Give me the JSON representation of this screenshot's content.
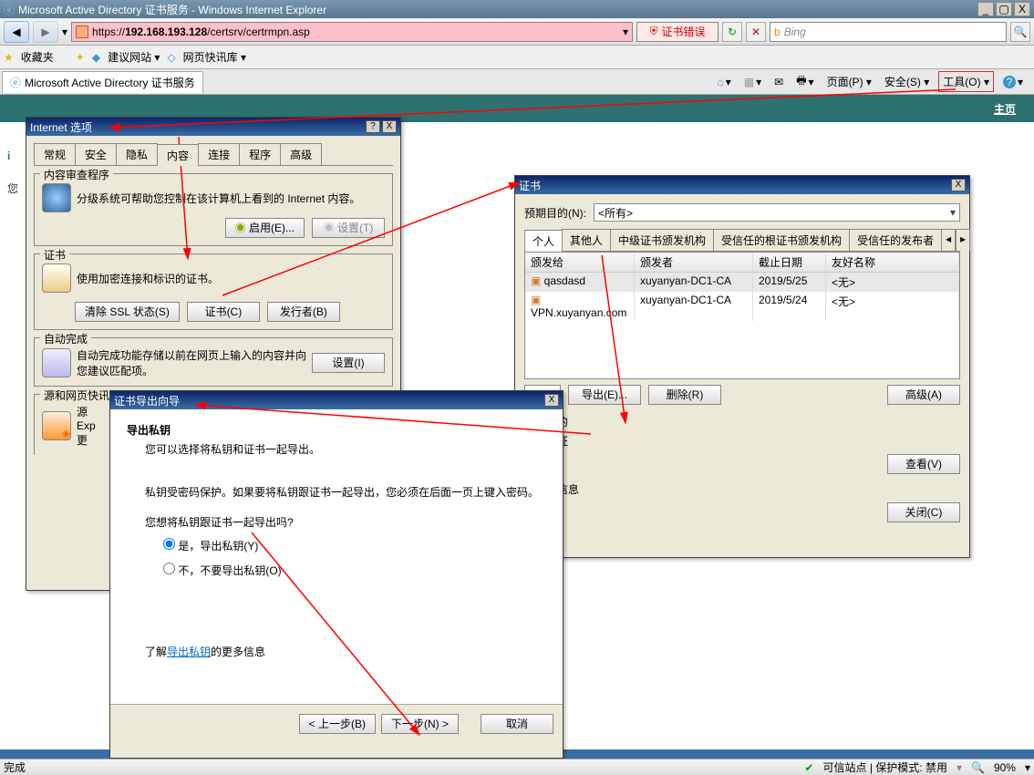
{
  "window": {
    "title": "Microsoft Active Directory 证书服务 - Windows Internet Explorer",
    "min": "_",
    "max": "▢",
    "close": "X"
  },
  "toolbar": {
    "url_prefix": "https://",
    "url_host": "192.168.193.128",
    "url_path": "/certsrv/certrmpn.asp",
    "cert_error": "证书错误",
    "search_placeholder": "Bing"
  },
  "favrow": {
    "label": "收藏夹",
    "suggest": "建议网站 ▾",
    "feed": "网页快讯库 ▾"
  },
  "tabrow": {
    "tab_title": "Microsoft Active Directory 证书服务",
    "menu": {
      "page": "页面(P) ▾",
      "safety": "安全(S) ▾",
      "tools": "工具(O) ▾"
    }
  },
  "page": {
    "homepage": "主页",
    "side1": "i",
    "side2": "您"
  },
  "internet_options": {
    "title": "Internet 选项",
    "tabs": [
      "常规",
      "安全",
      "隐私",
      "内容",
      "连接",
      "程序",
      "高级"
    ],
    "content_filter": {
      "label": "内容审查程序",
      "desc": "分级系统可帮助您控制在该计算机上看到的 Internet 内容。",
      "enable": "启用(E)...",
      "settings": "设置(T)"
    },
    "certificates": {
      "label": "证书",
      "desc": "使用加密连接和标识的证书。",
      "clear_ssl": "清除 SSL 状态(S)",
      "certs": "证书(C)",
      "issuers": "发行者(B)"
    },
    "autocomplete": {
      "label": "自动完成",
      "desc": "自动完成功能存储以前在网页上输入的内容并向您建议匹配项。",
      "settings": "设置(I)"
    },
    "feeds": {
      "label": "源和网页快讯",
      "desc1": "源",
      "desc2": "Exp",
      "desc3": "更"
    }
  },
  "cert_dialog": {
    "title": "证书",
    "purpose_label": "预期目的(N):",
    "purpose_value": "<所有>",
    "tabs": [
      "个人",
      "其他人",
      "中级证书颁发机构",
      "受信任的根证书颁发机构",
      "受信任的发布者"
    ],
    "columns": [
      "颁发给",
      "颁发者",
      "截止日期",
      "友好名称"
    ],
    "rows": [
      {
        "to": "qasdasd",
        "by": "xuyanyan-DC1-CA",
        "exp": "2019/5/25",
        "fn": "<无>"
      },
      {
        "to": "VPN.xuyanyan.com",
        "by": "xuyanyan-DC1-CA",
        "exp": "2019/5/24",
        "fn": "<无>"
      }
    ],
    "import": "...",
    "export": "导出(E)...",
    "remove": "删除(R)",
    "advanced": "高级(A)",
    "purpose2_label": "预期目的",
    "purpose2_value": "身份验证",
    "view": "查看(V)",
    "detail": "的详细信息",
    "close": "关闭(C)"
  },
  "wizard": {
    "title": "证书导出向导",
    "heading": "导出私钥",
    "sub": "您可以选择将私钥和证书一起导出。",
    "para1": "私钥受密码保护。如果要将私钥跟证书一起导出，您必须在后面一页上键入密码。",
    "question": "您想将私钥跟证书一起导出吗?",
    "opt_yes": "是，导出私钥(Y)",
    "opt_no": "不，不要导出私钥(O)",
    "learn_pre": "了解",
    "learn_link": "导出私钥",
    "learn_post": "的更多信息",
    "back": "< 上一步(B)",
    "next": "下一步(N) >",
    "cancel": "取消"
  },
  "status": {
    "done": "完成",
    "trusted": "可信站点 | 保护模式: 禁用",
    "zoom": "90%"
  }
}
